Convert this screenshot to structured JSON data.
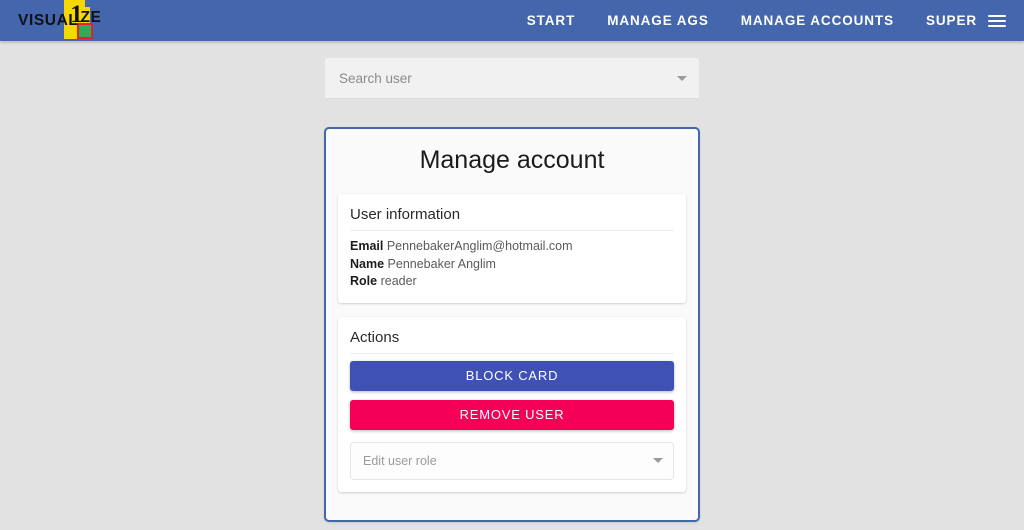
{
  "navbar": {
    "logo": {
      "text_left": "VISUAL",
      "digit": "1",
      "text_right": "ZE",
      "icon": "visualize-logo"
    },
    "links": [
      {
        "label": "START",
        "name": "nav-link-start"
      },
      {
        "label": "MANAGE AGS",
        "name": "nav-link-manage-ags"
      },
      {
        "label": "MANAGE ACCOUNTS",
        "name": "nav-link-manage-accounts"
      }
    ],
    "user_menu": {
      "label": "SUPER",
      "icon": "hamburger-menu-icon"
    },
    "background_color": "#4466ac"
  },
  "search": {
    "placeholder": "Search user",
    "value": "",
    "dropdown_icon": "chevron-down-icon"
  },
  "card": {
    "title": "Manage account",
    "border_color": "#4466ac",
    "user_information": {
      "heading": "User information",
      "fields": [
        {
          "label": "Email",
          "value": "PennebakerAnglim@hotmail.com"
        },
        {
          "label": "Name",
          "value": "Pennebaker Anglim"
        },
        {
          "label": "Role",
          "value": "reader"
        }
      ]
    },
    "actions": {
      "heading": "Actions",
      "block_card_label": "BLOCK CARD",
      "block_card_color": "#3f51b5",
      "remove_user_label": "REMOVE USER",
      "remove_user_color": "#f50057",
      "role_select": {
        "placeholder": "Edit user role",
        "value": "",
        "dropdown_icon": "chevron-down-icon"
      }
    }
  },
  "page": {
    "background_color": "#e2e2e2"
  }
}
